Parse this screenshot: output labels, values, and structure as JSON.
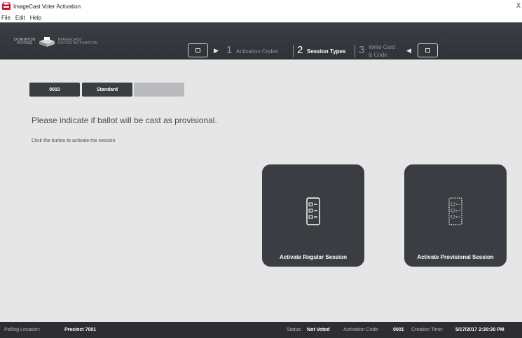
{
  "window": {
    "title": "ImageCast Voter Activation",
    "close": "X"
  },
  "menu": [
    "File",
    "Edit",
    "Help"
  ],
  "logo": {
    "brand_line1": "DOMINION",
    "brand_line2": "VOTING",
    "product_line1": "IMAGECAST",
    "product_line2": "VOTER ACTIVATION"
  },
  "steps": [
    {
      "number": "1",
      "label": "Activation Codes",
      "active": false
    },
    {
      "number": "2",
      "label": "Session Types",
      "active": true
    },
    {
      "number": "3",
      "label_line1": "Write Card",
      "label_line2": "& Code",
      "active": false
    }
  ],
  "tags": [
    "0010",
    "Standard",
    ""
  ],
  "prompt": "Please indicate if ballot will be cast as provisional.",
  "hint": "Click the button to activate the session",
  "buttons": {
    "regular": "Activate Regular Session",
    "provisional": "Activate Provisional Session"
  },
  "status": {
    "polling_location_label": "Polling Location:",
    "polling_location": "Precinct 7001",
    "status_label": "Status:",
    "status": "Not Voted",
    "activation_code_label": "Activation Code:",
    "activation_code": "0001",
    "creation_time_label": "Creation Time:",
    "creation_time": "5/17/2017 2:30:30 PM"
  },
  "colors": {
    "header": "#33363b",
    "tile": "#3a3d42",
    "tag_dark": "#3a3d42",
    "tag_empty": "#b9bbbe",
    "background": "#e6e6e6"
  }
}
